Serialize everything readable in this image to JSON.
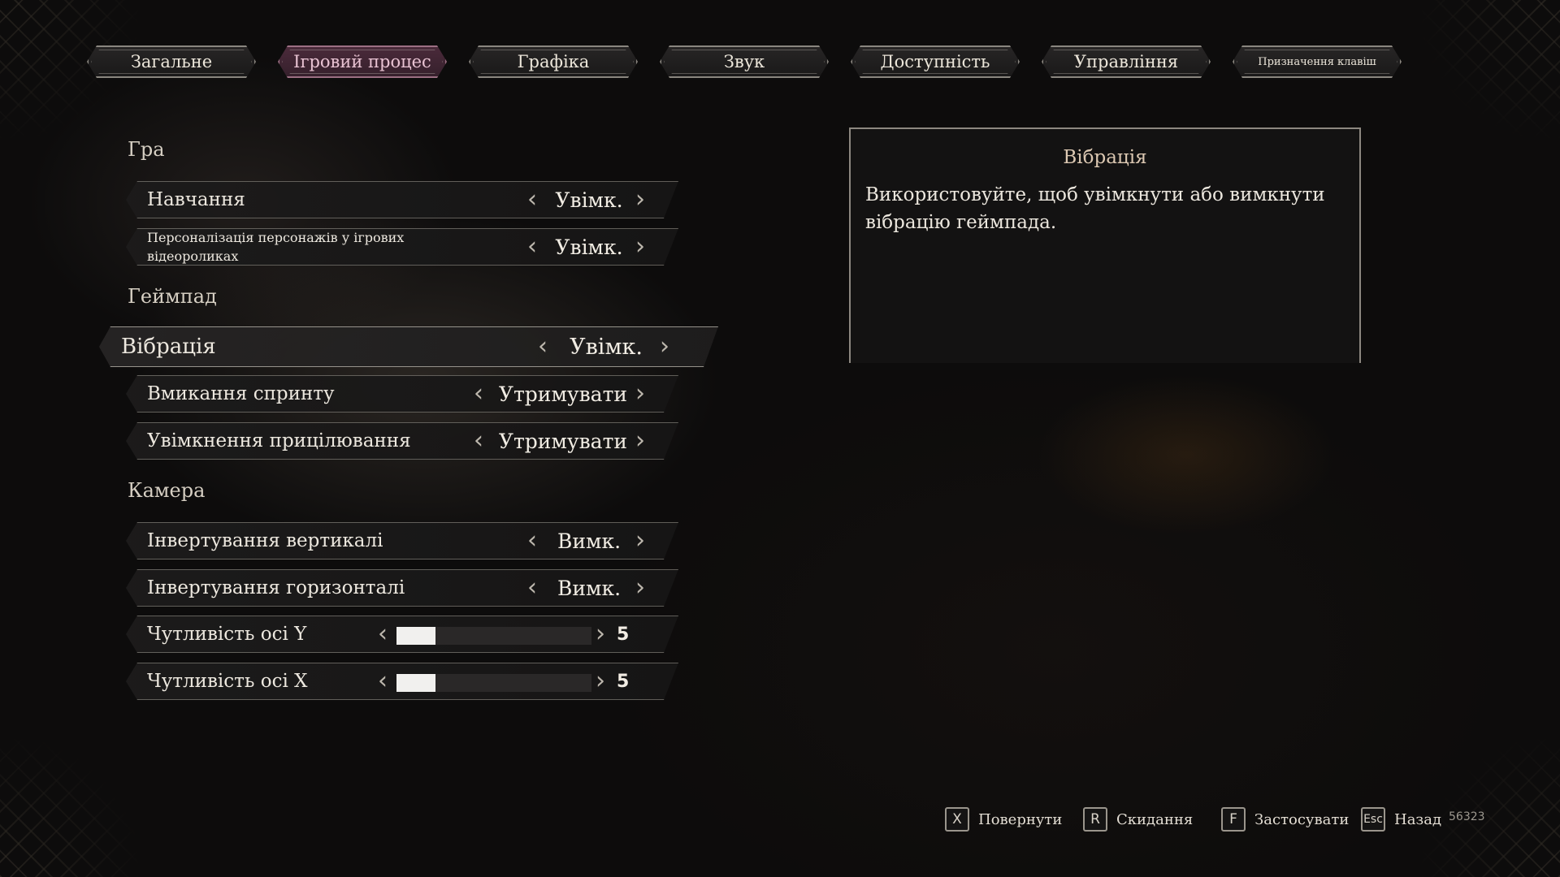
{
  "tabs": [
    {
      "label": "Загальне",
      "active": false
    },
    {
      "label": "Ігровий процес",
      "active": true
    },
    {
      "label": "Графіка",
      "active": false
    },
    {
      "label": "Звук",
      "active": false
    },
    {
      "label": "Доступність",
      "active": false
    },
    {
      "label": "Управління",
      "active": false
    },
    {
      "label": "Призначення клавіш",
      "active": false
    }
  ],
  "sections": {
    "game": {
      "title": "Гра",
      "rows": [
        {
          "label": "Навчання",
          "value": "Увімк."
        },
        {
          "label": "Персоналізація персонажів у ігрових відеороликах",
          "value": "Увімк."
        }
      ]
    },
    "gamepad": {
      "title": "Геймпад",
      "rows": [
        {
          "label": "Вібрація",
          "value": "Увімк."
        },
        {
          "label": "Вмикання спринту",
          "value": "Утримувати"
        },
        {
          "label": "Увімкнення прицілювання",
          "value": "Утримувати"
        }
      ]
    },
    "camera": {
      "title": "Камера",
      "rows": [
        {
          "label": "Інвертування вертикалі",
          "value": "Вимк."
        },
        {
          "label": "Інвертування горизонталі",
          "value": "Вимк."
        },
        {
          "label": "Чутливість осі Y",
          "value": "5",
          "fill": 0.2
        },
        {
          "label": "Чутливість осі X",
          "value": "5",
          "fill": 0.2
        }
      ]
    }
  },
  "description": {
    "title": "Вібрація",
    "text": "Використовуйте, щоб увімкнути або вимкнути вібрацію геймпада."
  },
  "footer": {
    "hints": [
      {
        "key": "X",
        "label": "Повернути"
      },
      {
        "key": "R",
        "label": "Скидання"
      },
      {
        "key": "F",
        "label": "Застосувати"
      },
      {
        "key": "Esc",
        "label": "Назад"
      }
    ],
    "version": "56323"
  },
  "colors": {
    "active_tab": "#4a2a3a",
    "active_tab_text": "#e9c3d3",
    "section_heading": "#d6cfc3",
    "slider_fill": "#f1f0ee"
  },
  "icons": {
    "prev": "chevron-left-icon",
    "next": "chevron-right-icon"
  }
}
